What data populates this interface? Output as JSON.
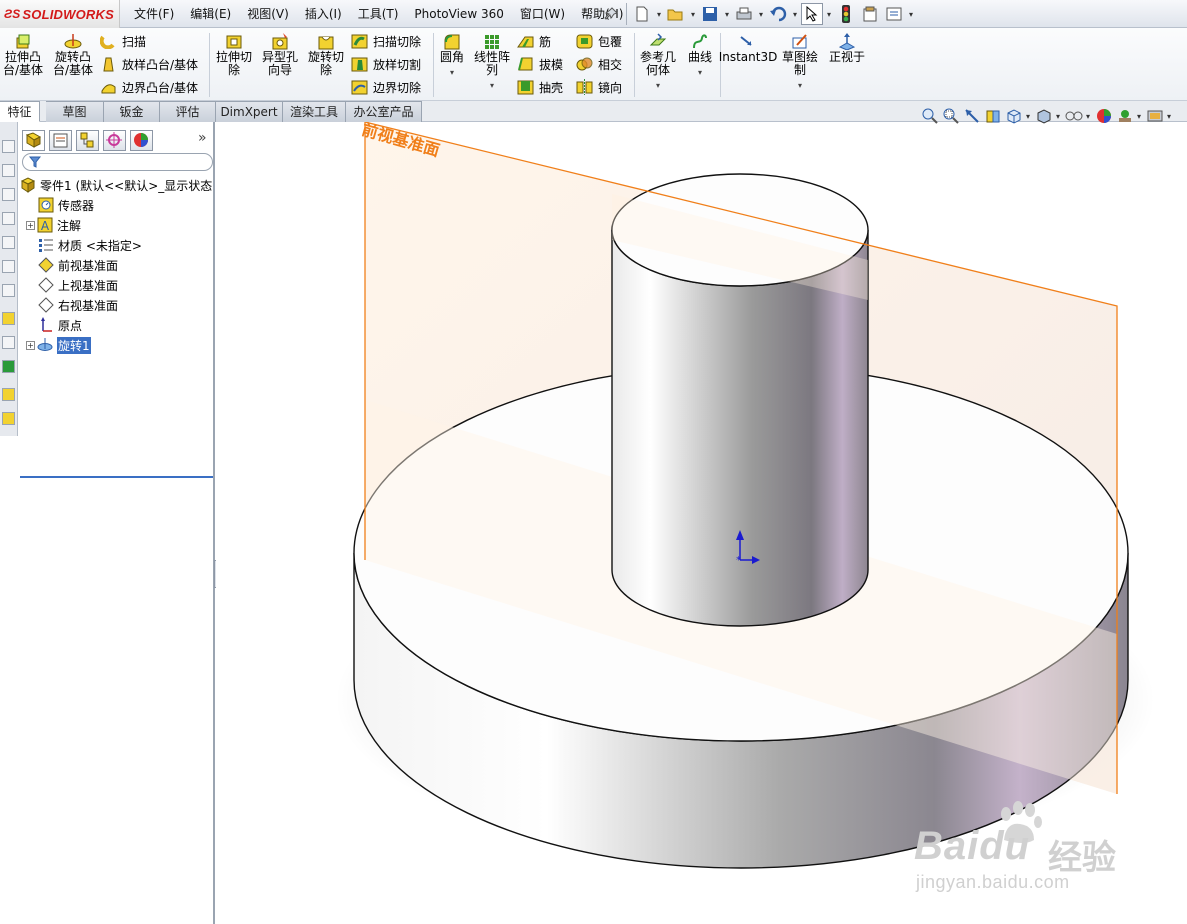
{
  "app": {
    "logo_text": "SOLIDWORKS",
    "logo_prefix": "ƧS"
  },
  "menu": [
    "文件(F)",
    "编辑(E)",
    "视图(V)",
    "插入(I)",
    "工具(T)",
    "PhotoView 360",
    "窗口(W)",
    "帮助(H)"
  ],
  "commands": {
    "extrude_boss": "拉伸凸台/基体",
    "revolve_boss": "旋转凸台/基体",
    "sweep": "扫描",
    "loft_boss": "放样凸台/基体",
    "boundary_boss": "边界凸台/基体",
    "extrude_cut": "拉伸切除",
    "hole_wizard": "异型孔向导",
    "revolve_cut": "旋转切除",
    "sweep_cut": "扫描切除",
    "loft_cut": "放样切割",
    "boundary_cut": "边界切除",
    "fillet": "圆角",
    "linear_pattern": "线性阵列",
    "rib": "筋",
    "draft": "拔模",
    "shell": "抽壳",
    "wrap": "包覆",
    "intersect": "相交",
    "mirror": "镜向",
    "ref_geometry": "参考几何体",
    "curves": "曲线",
    "instant3d": "Instant3D",
    "sketch": "草图绘制",
    "normal_to": "正视于"
  },
  "tabs": [
    "特征",
    "草图",
    "钣金",
    "评估",
    "DimXpert",
    "渲染工具",
    "办公室产品"
  ],
  "tree": {
    "root": "零件1  (默认<<默认>_显示状态",
    "items": [
      "传感器",
      "注解",
      "材质 <未指定>",
      "前视基准面",
      "上视基准面",
      "右视基准面",
      "原点",
      "旋转1"
    ]
  },
  "viewport": {
    "plane_label": "前视基准面"
  },
  "watermark": {
    "brand": "Baidu",
    "brand_cn": "经验",
    "url": "jingyan.baidu.com"
  },
  "colors": {
    "brand_red": "#d31a1a",
    "plane_orange": "#f07f1a",
    "selection_blue": "#3a6fc4"
  }
}
